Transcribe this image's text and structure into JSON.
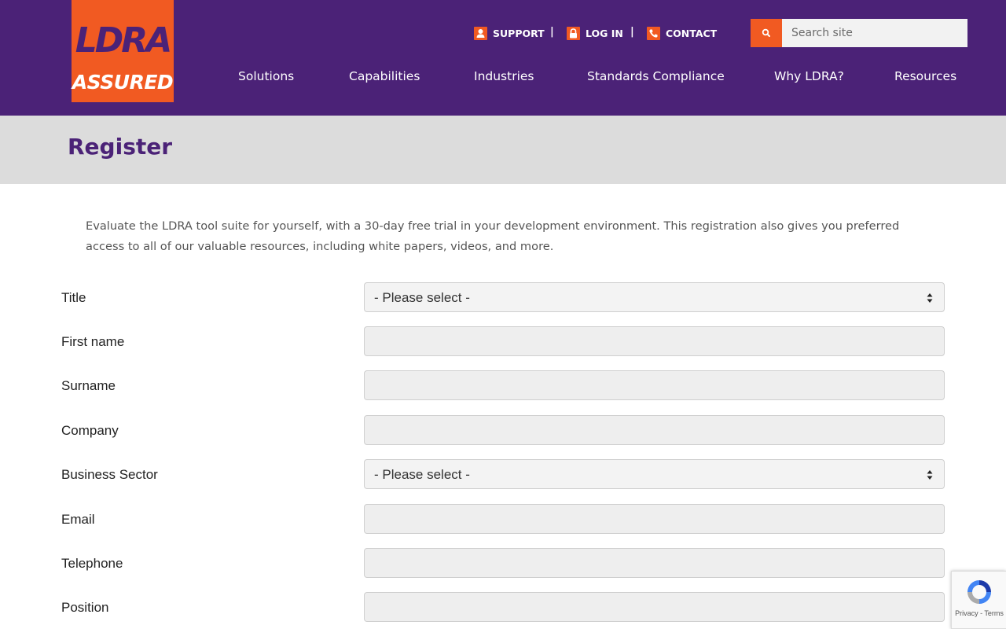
{
  "logo": {
    "wordmark": "LDRA",
    "tagline": "ASSURED"
  },
  "toplinks": {
    "support": "SUPPORT",
    "login": "LOG IN",
    "contact": "CONTACT",
    "separator": "|"
  },
  "search": {
    "placeholder": "Search site"
  },
  "nav": {
    "solutions": "Solutions",
    "capabilities": "Capabilities",
    "industries": "Industries",
    "standards": "Standards Compliance",
    "why": "Why LDRA?",
    "resources": "Resources"
  },
  "page": {
    "title": "Register",
    "intro": "Evaluate the LDRA tool suite for yourself, with a 30-day free trial in your development environment. This registration also gives you preferred access to all of our valuable resources, including white papers, videos, and more."
  },
  "form": {
    "title_label": "Title",
    "title_value": "- Please select -",
    "firstname_label": "First name",
    "surname_label": "Surname",
    "company_label": "Company",
    "sector_label": "Business Sector",
    "sector_value": "- Please select -",
    "email_label": "Email",
    "telephone_label": "Telephone",
    "position_label": "Position"
  },
  "recaptcha": {
    "links": "Privacy - Terms"
  },
  "colors": {
    "brand_purple": "#4b2277",
    "brand_orange": "#f15a22",
    "title_band": "#dcdcdc"
  },
  "icons": {
    "support": "user-icon",
    "login": "lock-icon",
    "contact": "phone-icon",
    "search": "search-icon",
    "select": "chevron-updown-icon"
  }
}
